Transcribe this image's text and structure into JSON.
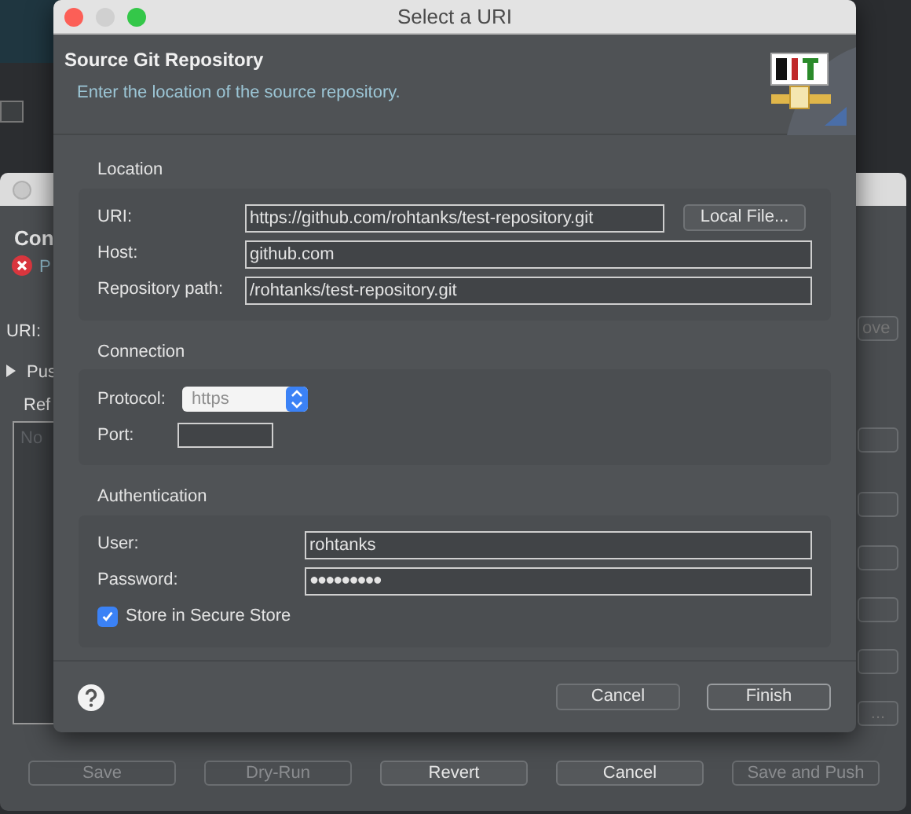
{
  "background_window": {
    "title": "Con",
    "status": "P",
    "uri_label": "URI:",
    "push_label": "Pus",
    "ref_label": "Ref",
    "list_placeholder": "No",
    "remove_button": "ove",
    "browse_button": "...",
    "buttons": [
      {
        "label": "Save",
        "disabled": true
      },
      {
        "label": "Dry-Run",
        "disabled": true
      },
      {
        "label": "Revert",
        "disabled": false
      },
      {
        "label": "Cancel",
        "disabled": false
      },
      {
        "label": "Save and Push",
        "disabled": true
      }
    ]
  },
  "dialog": {
    "title": "Select a URI",
    "header": {
      "title": "Source Git Repository",
      "description": "Enter the location of the source repository."
    },
    "sections": [
      {
        "title": "Location",
        "fields": [
          {
            "kind": "text",
            "label": "URI:",
            "value": "https://github.com/rohtanks/test-repository.git",
            "button": "Local File..."
          },
          {
            "kind": "text",
            "label": "Host:",
            "value": "github.com"
          },
          {
            "kind": "text",
            "label": "Repository path:",
            "value": "/rohtanks/test-repository.git"
          }
        ]
      },
      {
        "title": "Connection",
        "fields": [
          {
            "kind": "combo",
            "label": "Protocol:",
            "value": "https",
            "disabled": true
          },
          {
            "kind": "short",
            "label": "Port:"
          }
        ]
      },
      {
        "title": "Authentication",
        "fields": [
          {
            "kind": "text",
            "label": "User:",
            "value": "rohtanks"
          },
          {
            "kind": "password",
            "label": "Password:",
            "value": "●●●●●●●●●"
          },
          {
            "kind": "checkbox",
            "label": "Store in Secure Store",
            "checked": true
          }
        ]
      }
    ],
    "buttons": [
      {
        "label": "Cancel",
        "default": false
      },
      {
        "label": "Finish",
        "default": true
      }
    ]
  }
}
